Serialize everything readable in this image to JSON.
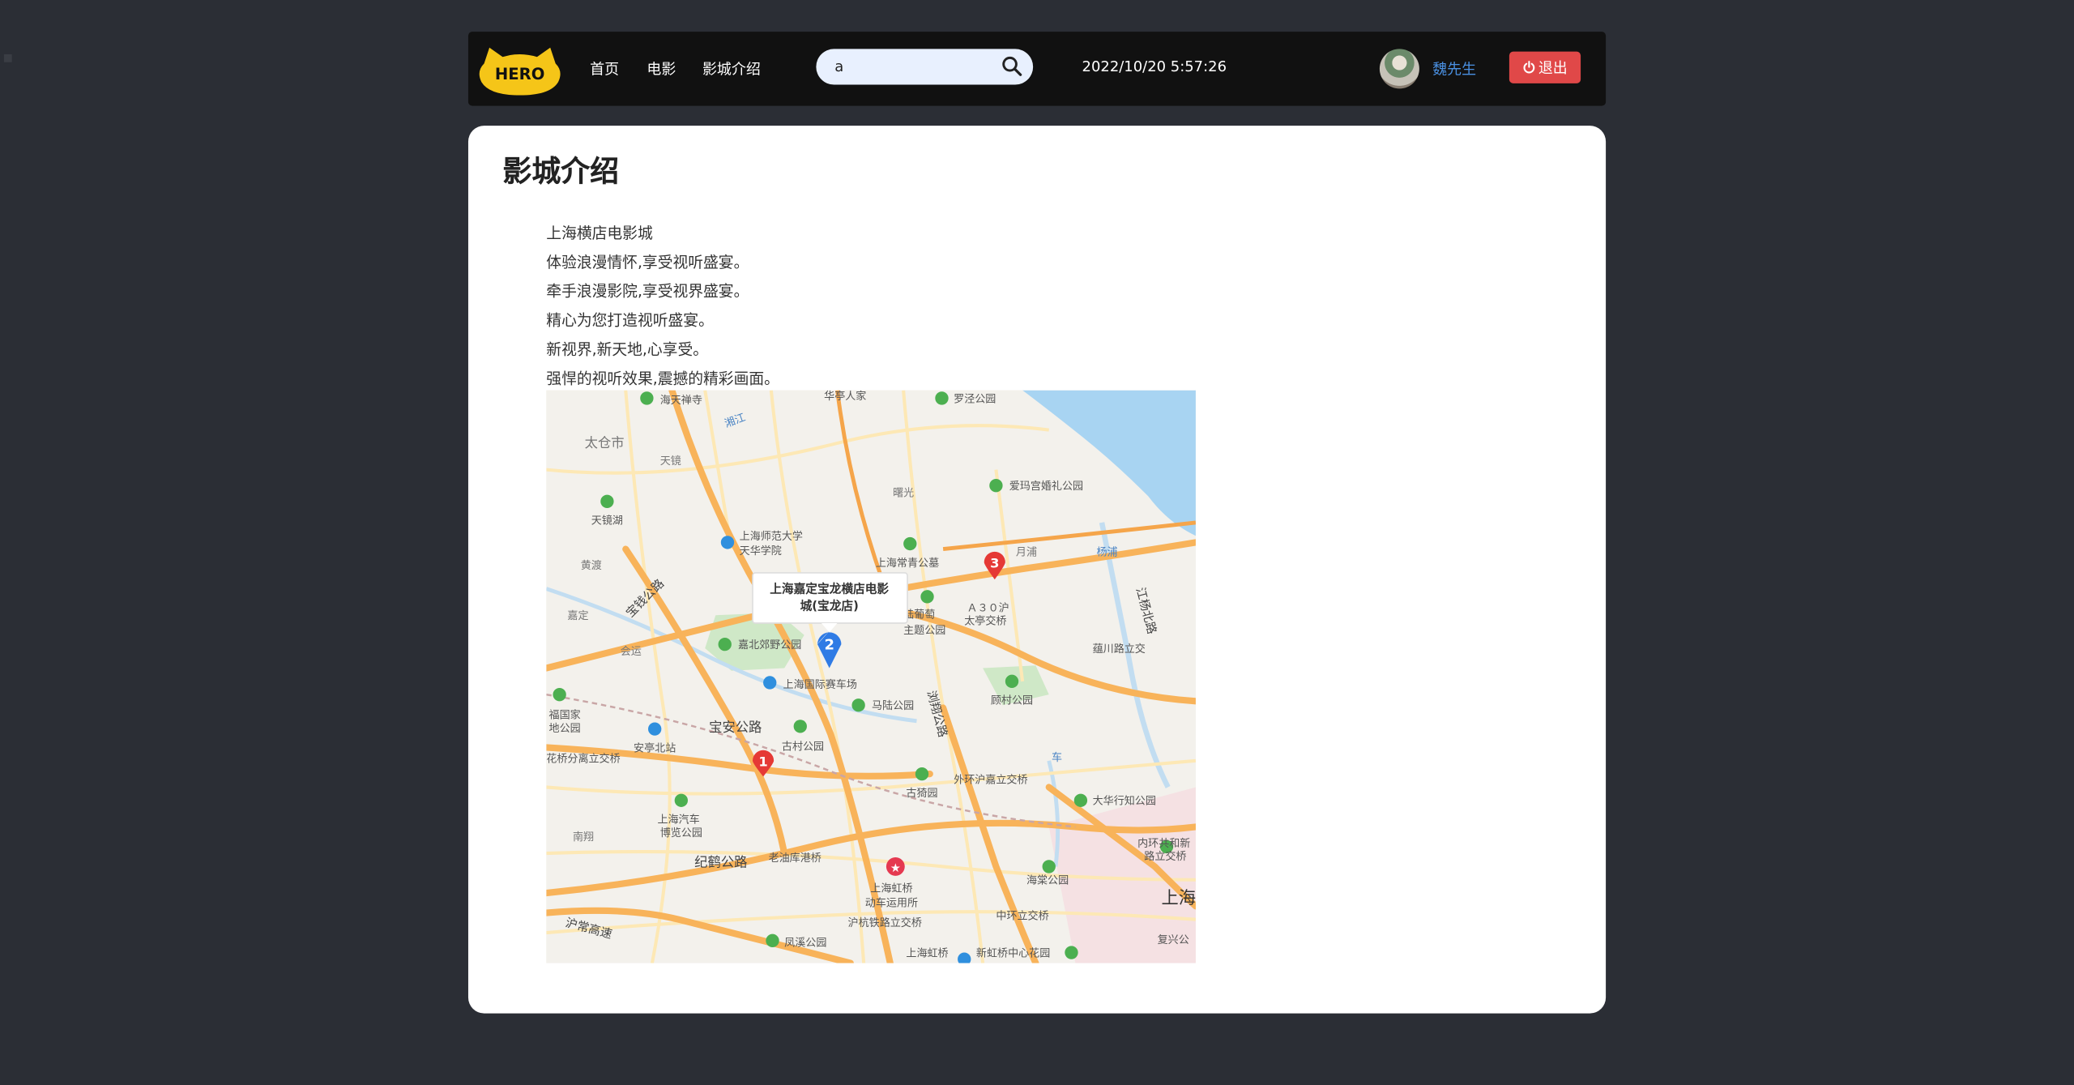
{
  "navbar": {
    "logo_text": "HERO",
    "links": [
      "首页",
      "电影",
      "影城介绍"
    ],
    "search": {
      "value": "a",
      "placeholder": ""
    },
    "datetime": "2022/10/20 5:57:26",
    "username": "魏先生",
    "logout_label": "退出"
  },
  "page": {
    "title": "影城介绍",
    "lines": [
      "上海横店电影城",
      "体验浪漫情怀,享受视听盛宴。",
      "牵手浪漫影院,享受视界盛宴。",
      "精心为您打造视听盛宴。",
      "新视界,新天地,心享受。",
      "强悍的视听效果,震撼的精彩画面。"
    ]
  },
  "map": {
    "popup": [
      "上海嘉定宝龙横店电影",
      "城(宝龙店)"
    ],
    "markers": [
      "1",
      "2",
      "3"
    ],
    "labels": {
      "taicang": "太仓市",
      "haitian": "海天禅寺",
      "huaren": "华亭人家",
      "luojing": "罗泾公园",
      "tianjinghu": "天镜湖",
      "shida": "上海师范大学",
      "tianhua": "天华学院",
      "changqing": "上海常青公墓",
      "amada": "爱玛宫婚礼公园",
      "jiading_park": "嘉北郊野公园",
      "circuit": "上海国际赛车场",
      "a30": "Ａ３０沪",
      "taiting": "太亭交桥",
      "putao": "陆葡萄",
      "zhuti": "主题公园",
      "yunchuan": "蕴川路立交",
      "gucun": "顾村公园",
      "malu": "马陆公园",
      "baoan": "宝安公路",
      "anting": "安亭北站",
      "guzheng": "古村公园",
      "waihuan": "外环沪嘉立交桥",
      "guyi": "古猗园",
      "dahua": "大华行知公园",
      "ring_w": "花桥分离立交桥",
      "shanghai_auto": "上海汽车",
      "bolan": "博览公园",
      "jihe": "纪鹤公路",
      "laoyou": "老油库港桥",
      "hongqiao": "上海虹桥",
      "dongche": "动车运用所",
      "hujie": "沪杭铁路立交桥",
      "haitang": "海棠公园",
      "zhonghuan": "中环立交桥",
      "shanghai": "上海",
      "neihuan": "内环共和新",
      "luli": "路立交桥",
      "fengxi": "凤溪公园",
      "hongqiao_bottom": "上海虹桥",
      "xinhong": "新虹桥中心花园",
      "huchang": "沪常高速",
      "fuxing": "复兴公",
      "yanghua": "杨浦",
      "jiangyang": "江杨北路",
      "huanglai": "黄渡",
      "xiangjiang": "湘江",
      "shuguang": "曙光",
      "baoqian": "宝钱公路",
      "jiading": "嘉定",
      "fuhuaguo": "福国家",
      "dimpark": "地公园",
      "nanxiang": "南翔",
      "liuxiang": "浏翔公路",
      "chexiang": "车",
      "tianjing": "天镜",
      "yueyang": "月浦",
      "huiyun": "会运"
    }
  }
}
